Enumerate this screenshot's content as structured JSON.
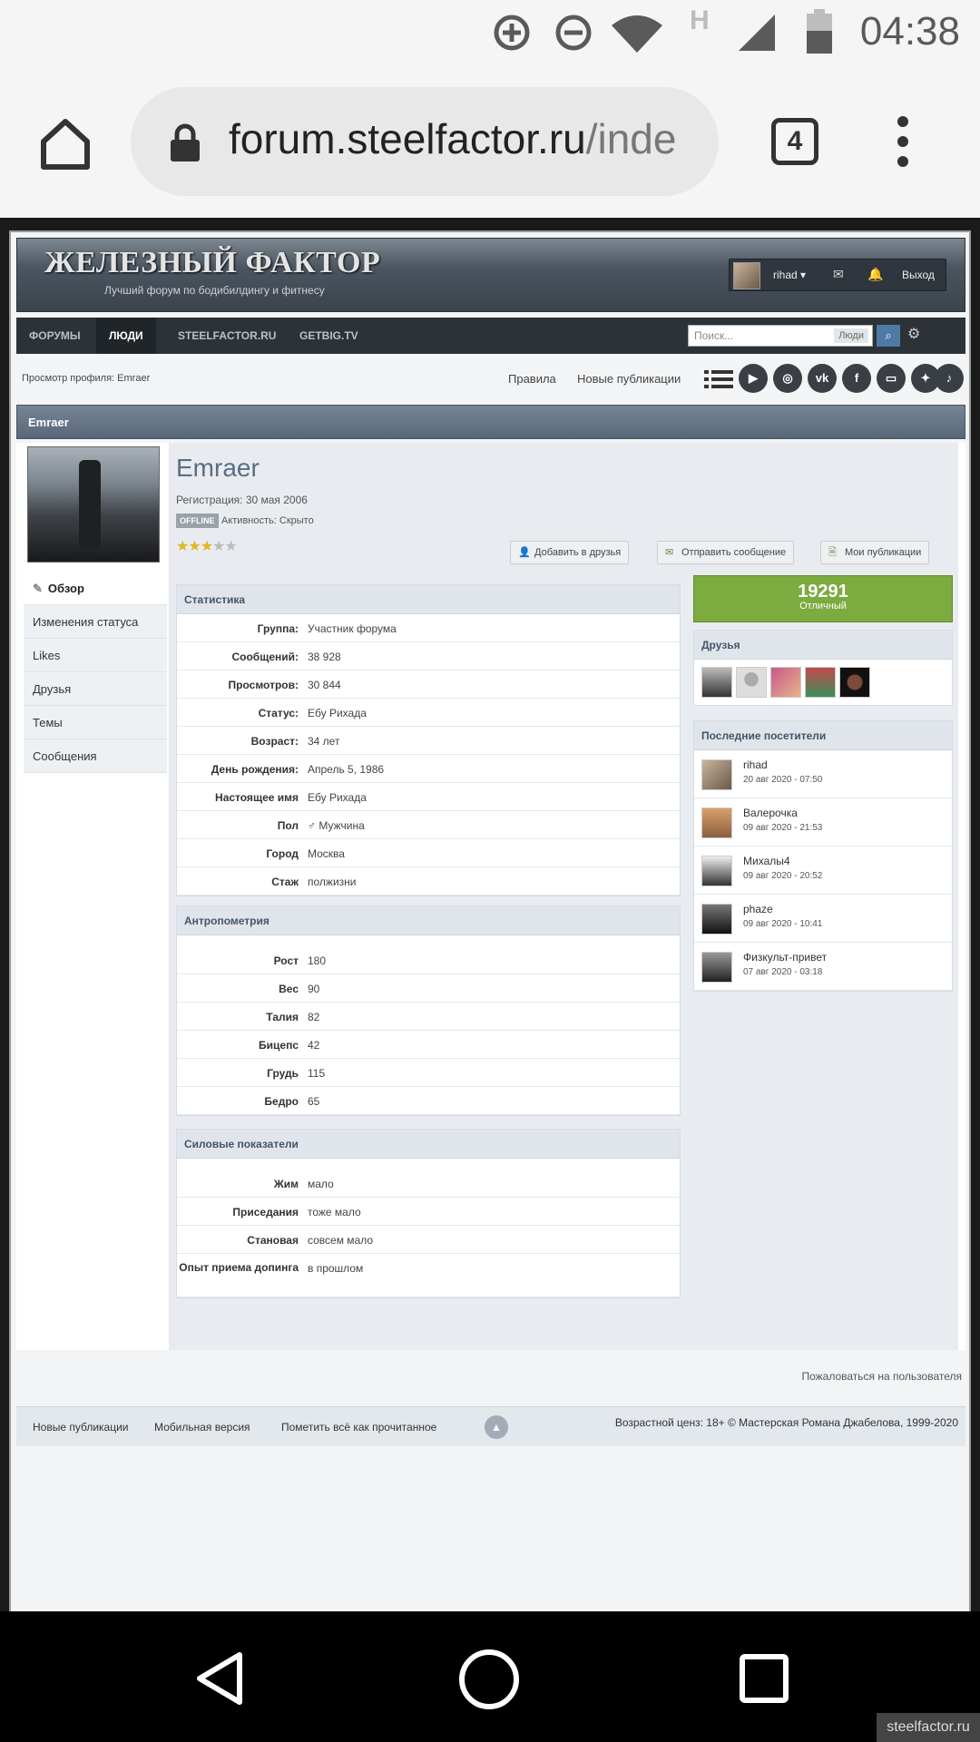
{
  "status_bar": {
    "time": "04:38",
    "icons": [
      "data-saver-icon",
      "do-not-disturb-icon",
      "wifi-icon",
      "h-network-icon",
      "signal-icon",
      "battery-icon"
    ],
    "network_letter": "H"
  },
  "browser": {
    "url_host": "forum.steelfactor.ru",
    "url_path": "/inde",
    "tab_count": "4"
  },
  "site": {
    "logo": "ЖЕЛЕЗНЫЙ ФАКТОР",
    "tagline": "Лучший форум по бодибилдингу и фитнесу",
    "user": {
      "name": "rihad ▾",
      "logout": "Выход"
    },
    "nav": [
      "ФОРУМЫ",
      "ЛЮДИ",
      "STEELFACTOR.RU",
      "GETBIG.TV"
    ],
    "search": {
      "placeholder": "Поиск...",
      "scope": "Люди"
    },
    "breadcrumb": "Просмотр профиля: Emraer",
    "links": {
      "rules": "Правила",
      "new_pubs": "Новые публикации"
    },
    "socials": [
      "youtube-icon",
      "instagram-icon",
      "vk-icon",
      "facebook-icon",
      "twitch-icon",
      "twitter-icon",
      "tiktok-icon"
    ]
  },
  "profile": {
    "title": "Emraer",
    "name": "Emraer",
    "registration": "Регистрация: 30 мая 2006",
    "offline": "OFFLINE",
    "activity": "Активность: Скрыто",
    "rating": 3,
    "rating_max": 5,
    "buttons": {
      "add_friend": "Добавить в друзья",
      "send_message": "Отправить сообщение",
      "my_pubs": "Мои публикации"
    },
    "side_menu": [
      "Обзор",
      "Изменения статуса",
      "Likes",
      "Друзья",
      "Темы",
      "Сообщения"
    ],
    "stats_title": "Статистика",
    "stats": [
      {
        "k": "Группа:",
        "v": "Участник форума"
      },
      {
        "k": "Сообщений:",
        "v": "38 928"
      },
      {
        "k": "Просмотров:",
        "v": "30 844"
      },
      {
        "k": "Статус:",
        "v": "Ебу Рихада"
      },
      {
        "k": "Возраст:",
        "v": "34 лет"
      },
      {
        "k": "День рождения:",
        "v": "Апрель 5, 1986"
      },
      {
        "k": "Настоящее имя",
        "v": "Ебу Рихада"
      },
      {
        "k": "Пол",
        "v": "♂ Мужчина"
      },
      {
        "k": "Город",
        "v": "Москва"
      },
      {
        "k": "Стаж",
        "v": "полжизни"
      }
    ],
    "anthro_title": "Антропометрия",
    "anthro": [
      {
        "k": "Рост",
        "v": "180"
      },
      {
        "k": "Вес",
        "v": "90"
      },
      {
        "k": "Талия",
        "v": "82"
      },
      {
        "k": "Бицепс",
        "v": "42"
      },
      {
        "k": "Грудь",
        "v": "115"
      },
      {
        "k": "Бедро",
        "v": "65"
      }
    ],
    "power_title": "Силовые показатели",
    "power": [
      {
        "k": "Жим",
        "v": "мало"
      },
      {
        "k": "Приседания",
        "v": "тоже мало"
      },
      {
        "k": "Становая",
        "v": "совсем мало"
      },
      {
        "k": "Опыт приема допинга",
        "v": "в прошлом"
      }
    ],
    "reputation": {
      "value": "19291",
      "label": "Отличный"
    },
    "friends_title": "Друзья",
    "visitors_title": "Последние посетители",
    "visitors": [
      {
        "name": "rihad",
        "date": "20 авг 2020 - 07:50"
      },
      {
        "name": "Валерочка",
        "date": "09 авг 2020 - 21:53"
      },
      {
        "name": "Михалы4",
        "date": "09 авг 2020 - 20:52"
      },
      {
        "name": "phaze",
        "date": "09 авг 2020 - 10:41"
      },
      {
        "name": "Физкульт-привет",
        "date": "07 авг 2020 - 03:18"
      }
    ]
  },
  "footer": {
    "complain": "Пожаловаться на пользователя",
    "links": [
      "Новые публикации",
      "Мобильная версия",
      "Пометить всё как прочитанное"
    ],
    "copyright": "Возрастной ценз: 18+  © Мастерская Романа Джабелова, 1999-2020"
  },
  "watermark": "steelfactor.ru"
}
